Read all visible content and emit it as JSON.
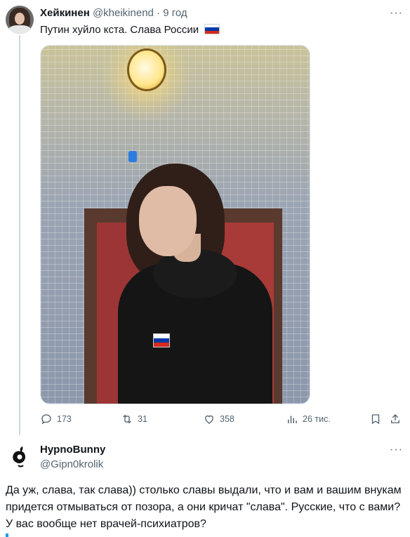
{
  "tweet": {
    "name": "Хейкинен",
    "handle": "@kheikinend",
    "separator": "·",
    "time": "9 год",
    "text": "Путин хуйло кста. Слава России",
    "flag_colors": [
      "#ffffff",
      "#0039a6",
      "#d52b1e"
    ],
    "more_label": "···"
  },
  "actions": {
    "replies": "173",
    "reposts": "31",
    "likes": "358",
    "views": "26 тис.",
    "icons": [
      "reply-icon",
      "repost-icon",
      "like-icon",
      "views-icon",
      "bookmark-icon",
      "share-icon"
    ]
  },
  "reply": {
    "name": "HypnoBunny",
    "handle": "@Gipn0krolik",
    "more_label": "···",
    "text": "Да уж, слава, так слава)) столько славы выдали, что и вам и вашим внукам придется отмываться от позора, а они кричат \"слава\". Русские, что с вами? У вас вообще нет врачей-психиатров?"
  },
  "colors": {
    "accent": "#1d9bf0",
    "muted": "#536471",
    "text": "#0f1419"
  }
}
